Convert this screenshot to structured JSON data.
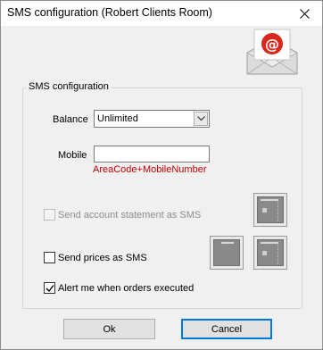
{
  "window": {
    "title": "SMS configuration (Robert Clients Room)"
  },
  "group": {
    "label": "SMS configuration"
  },
  "balance": {
    "label": "Balance",
    "selected": "Unlimited"
  },
  "mobile": {
    "label": "Mobile",
    "value": "",
    "hint": "AreaCode+MobileNumber"
  },
  "options": {
    "send_statement": {
      "label": "Send account statement as SMS",
      "checked": false,
      "enabled": false
    },
    "send_prices": {
      "label": "Send prices as SMS",
      "checked": false,
      "enabled": true
    },
    "alert_orders": {
      "label": "Alert me when orders executed",
      "checked": true,
      "enabled": true
    }
  },
  "buttons": {
    "ok": "Ok",
    "cancel": "Cancel"
  },
  "icons": {
    "close": "close-icon",
    "header": "email-envelope-icon",
    "statement_doc": "document-icon",
    "prices_doc": "document-icon"
  },
  "colors": {
    "hint": "#c00000",
    "email_red": "#d9271c",
    "default_button_border": "#0078d7"
  }
}
